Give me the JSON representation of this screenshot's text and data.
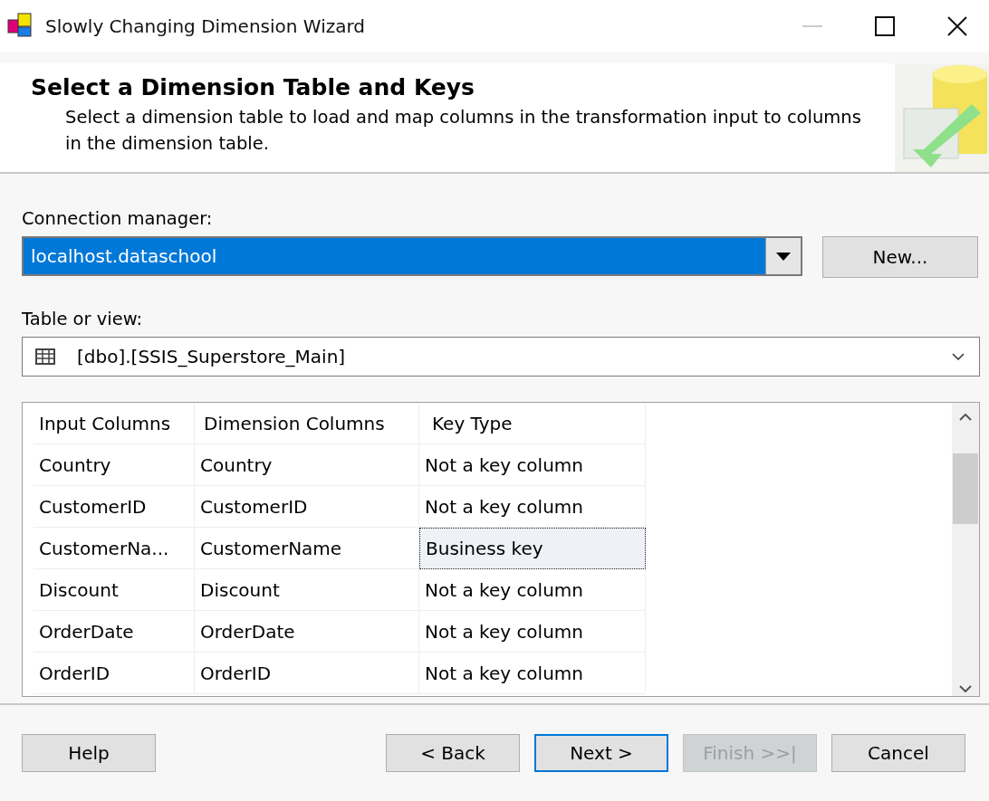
{
  "window": {
    "title": "Slowly Changing Dimension Wizard"
  },
  "header": {
    "title": "Select a Dimension Table and Keys",
    "description": "Select a dimension table to load and map columns in the transformation input to columns in the dimension table."
  },
  "connection_manager": {
    "label": "Connection manager:",
    "value": "localhost.dataschool",
    "new_button": "New..."
  },
  "table_or_view": {
    "label": "Table or view:",
    "value": "[dbo].[SSIS_Superstore_Main]"
  },
  "table": {
    "columns": [
      "Input Columns",
      "Dimension Columns",
      "Key Type"
    ],
    "rows": [
      {
        "input": "Country",
        "dimension": "Country",
        "key_type": "Not a key column",
        "selected": false
      },
      {
        "input": "CustomerID",
        "dimension": "CustomerID",
        "key_type": "Not a key column",
        "selected": false
      },
      {
        "input": "CustomerNa...",
        "dimension": "CustomerName",
        "key_type": "Business key",
        "selected": true
      },
      {
        "input": "Discount",
        "dimension": "Discount",
        "key_type": "Not a key column",
        "selected": false
      },
      {
        "input": "OrderDate",
        "dimension": "OrderDate",
        "key_type": "Not a key column",
        "selected": false
      },
      {
        "input": "OrderID",
        "dimension": "OrderID",
        "key_type": "Not a key column",
        "selected": false
      }
    ]
  },
  "buttons": [
    {
      "label": "Help",
      "default": false,
      "disabled": false
    },
    {
      "label": "< Back",
      "default": false,
      "disabled": false
    },
    {
      "label": "Next >",
      "default": true,
      "disabled": false
    },
    {
      "label": "Finish >>|",
      "default": false,
      "disabled": true
    },
    {
      "label": "Cancel",
      "default": false,
      "disabled": false
    }
  ]
}
